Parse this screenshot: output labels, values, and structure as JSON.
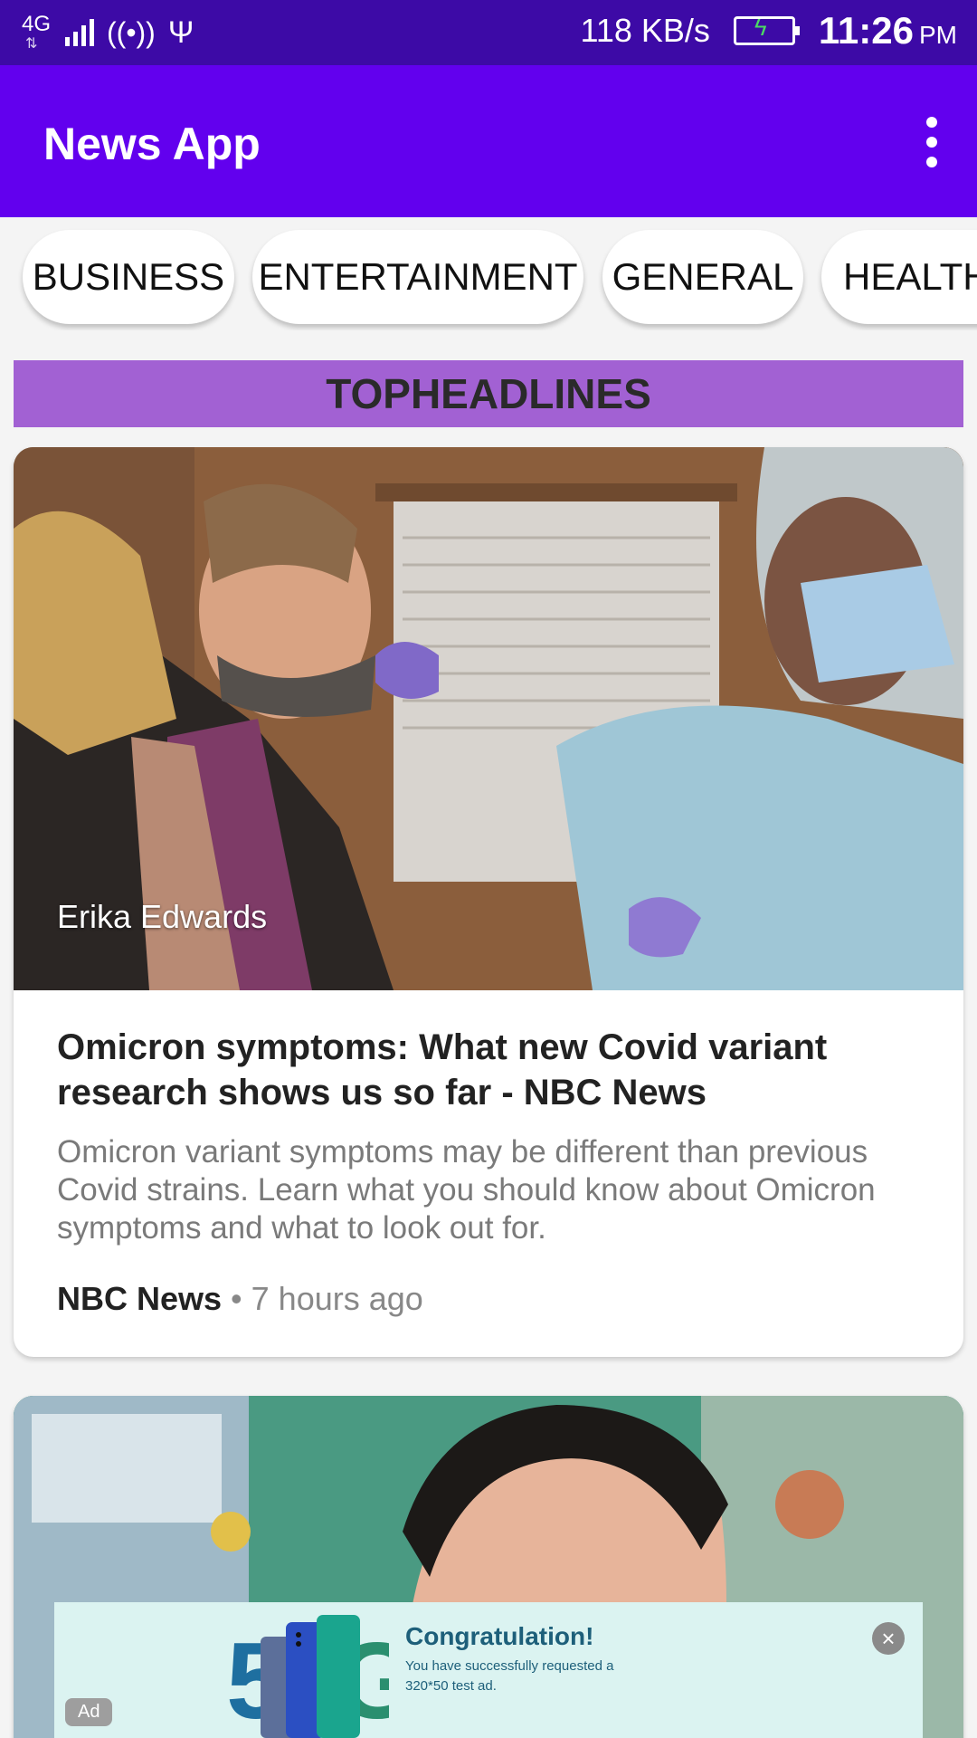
{
  "status_bar": {
    "network": "4G",
    "speed": "118 KB/s",
    "time": "11:26",
    "ampm": "PM"
  },
  "app_bar": {
    "title": "News App"
  },
  "categories": [
    "BUSINESS",
    "ENTERTAINMENT",
    "GENERAL",
    "HEALTH"
  ],
  "section_header": "TOPHEADLINES",
  "articles": [
    {
      "author": "Erika Edwards",
      "title": "Omicron symptoms: What new Covid variant research shows us so far - NBC News",
      "description": "Omicron variant symptoms may be different than previous Covid strains. Learn what you should know about Omicron symptoms and what to look out for.",
      "source": "NBC News",
      "separator": "•",
      "time": "7 hours ago"
    }
  ],
  "ad": {
    "badge": "Ad",
    "title": "Congratulation!",
    "body": "You have successfully requested a 320*50 test ad."
  },
  "colors": {
    "status_bar": "#3d0aa6",
    "app_bar": "#6200ee",
    "section_header": "#a261d3",
    "ad_background": "#dbf3f1"
  },
  "icons": [
    "network-icon",
    "signal-icon",
    "hotspot-icon",
    "usb-icon",
    "battery-icon",
    "more-vert-icon",
    "ad-close-icon"
  ]
}
